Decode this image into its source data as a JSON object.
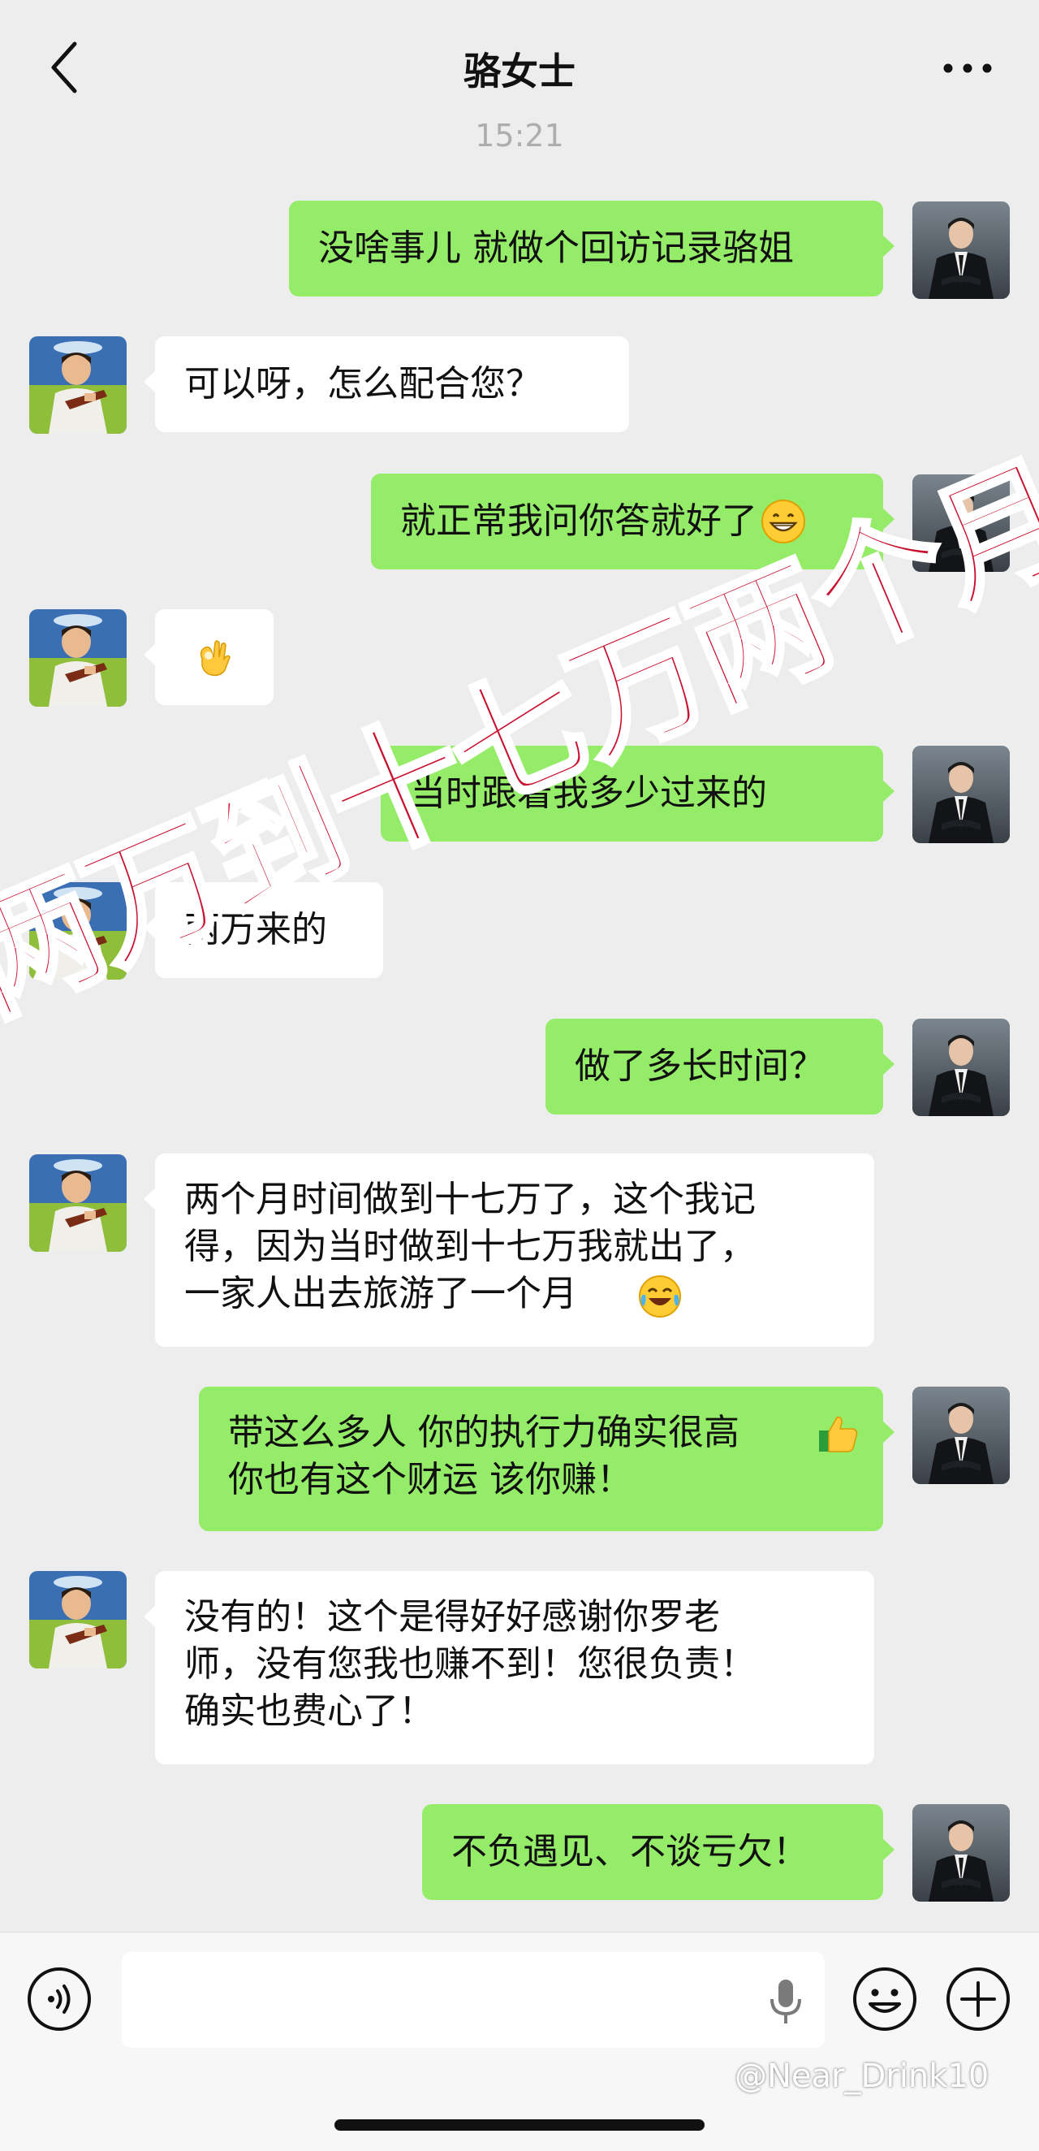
{
  "header": {
    "title": "骆女士",
    "back_icon": "chevron-left-icon",
    "more_icon": "ellipsis-icon"
  },
  "timestamp": "15:21",
  "messages": [
    {
      "from": "me",
      "text": "没啥事儿 就做个回访记录骆姐"
    },
    {
      "from": "them",
      "text": "可以呀，怎么配合您？"
    },
    {
      "from": "me",
      "text": "就正常我问你答就好了",
      "emoji": "grinning-face"
    },
    {
      "from": "them",
      "emoji": "ok-hand"
    },
    {
      "from": "me",
      "text": "当时跟着我多少过来的"
    },
    {
      "from": "them",
      "text": "两万来的"
    },
    {
      "from": "me",
      "text": "做了多长时间？"
    },
    {
      "from": "them",
      "text": "两个月时间做到十七万了，这个我记\n得，因为当时做到十七万我就出了，\n一家人出去旅游了一个月",
      "emoji": "tears-of-joy"
    },
    {
      "from": "me",
      "text": "带这么多人 你的执行力确实很高\n你也有这个财运 该你赚！",
      "emoji": "thumbs-up"
    },
    {
      "from": "them",
      "text": "没有的！这个是得好好感谢你罗老\n师，没有您我也赚不到！您很负责！\n确实也费心了！"
    },
    {
      "from": "me",
      "text": "不负遇见、不谈亏欠！"
    }
  ],
  "overlay_text": "两万到十七万两个月",
  "bottom_bar": {
    "voice_icon": "voice-icon",
    "mic_icon": "microphone-icon",
    "emoji_icon": "smiley-icon",
    "plus_icon": "plus-icon"
  },
  "watermark": "@Near_Drink10",
  "colors": {
    "outgoing_bubble": "#95ec69",
    "incoming_bubble": "#ffffff",
    "overlay_text": "#c8102e",
    "background": "#ededed"
  }
}
